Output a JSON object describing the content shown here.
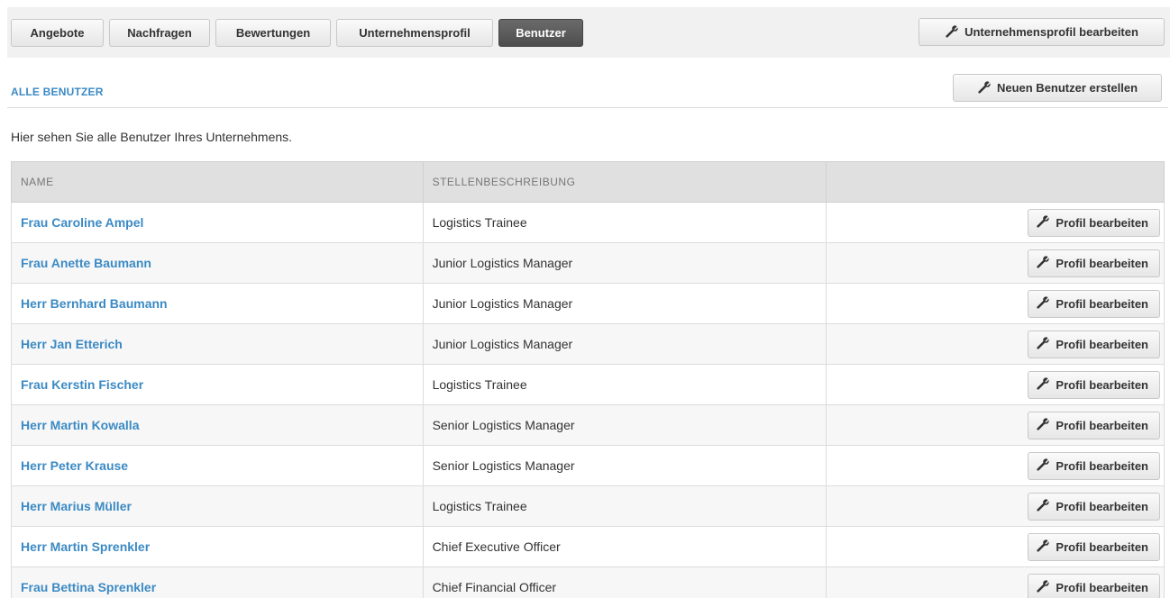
{
  "tabs": [
    {
      "label": "Angebote",
      "active": false
    },
    {
      "label": "Nachfragen",
      "active": false
    },
    {
      "label": "Bewertungen",
      "active": false
    },
    {
      "label": "Unternehmensprofil",
      "active": false
    },
    {
      "label": "Benutzer",
      "active": true
    }
  ],
  "toolbar": {
    "edit_company_label": "Unternehmensprofil bearbeiten"
  },
  "section": {
    "title": "ALLE BENUTZER",
    "new_user_label": "Neuen Benutzer erstellen",
    "intro": "Hier sehen Sie alle Benutzer Ihres Unternehmens."
  },
  "table": {
    "headers": [
      "NAME",
      "STELLENBESCHREIBUNG",
      ""
    ],
    "action_label": "Profil bearbeiten",
    "rows": [
      {
        "name": "Frau Caroline Ampel",
        "job": "Logistics Trainee"
      },
      {
        "name": "Frau Anette Baumann",
        "job": "Junior Logistics Manager"
      },
      {
        "name": "Herr Bernhard Baumann",
        "job": "Junior Logistics Manager"
      },
      {
        "name": "Herr Jan Etterich",
        "job": "Junior Logistics Manager"
      },
      {
        "name": "Frau Kerstin Fischer",
        "job": "Logistics Trainee"
      },
      {
        "name": "Herr Martin Kowalla",
        "job": "Senior Logistics Manager"
      },
      {
        "name": "Herr Peter Krause",
        "job": "Senior Logistics Manager"
      },
      {
        "name": "Herr Marius Müller",
        "job": "Logistics Trainee"
      },
      {
        "name": "Herr Martin Sprenkler",
        "job": "Chief Executive Officer"
      },
      {
        "name": "Frau Bettina Sprenkler",
        "job": "Chief Financial Officer"
      }
    ]
  },
  "icons": {
    "edit": "wrench-icon"
  },
  "colors": {
    "link": "#3b8ac4",
    "active_tab": "#555555",
    "header_bg": "#e0e0e0"
  }
}
